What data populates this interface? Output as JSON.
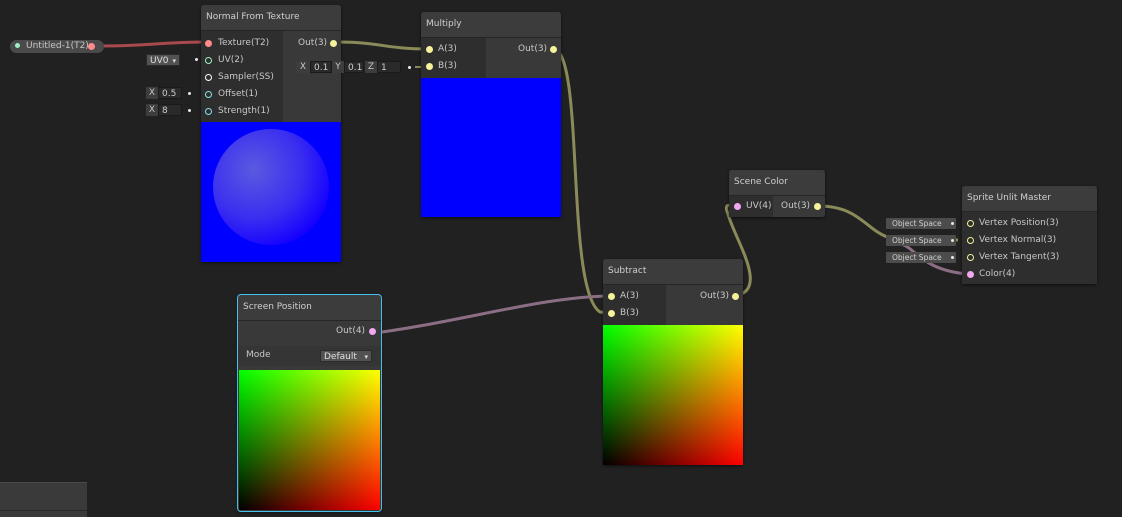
{
  "property_pill": {
    "label": "Untitled-1(T2)"
  },
  "normal_from_texture": {
    "title": "Normal From Texture",
    "inputs": [
      "Texture(T2)",
      "UV(2)",
      "Sampler(SS)",
      "Offset(1)",
      "Strength(1)"
    ],
    "output": "Out(3)",
    "uv_channel": "UV0",
    "offset": {
      "axis": "X",
      "value": "0.5"
    },
    "strength": {
      "axis": "X",
      "value": "8"
    }
  },
  "multiply": {
    "title": "Multiply",
    "inputs": [
      "A(3)",
      "B(3)"
    ],
    "output": "Out(3)",
    "b_value": {
      "x_label": "X",
      "x": "0.1",
      "y_label": "Y",
      "y": "0.1",
      "z_label": "Z",
      "z": "1"
    }
  },
  "screen_position": {
    "title": "Screen Position",
    "output": "Out(4)",
    "mode_label": "Mode",
    "mode_value": "Default"
  },
  "subtract": {
    "title": "Subtract",
    "inputs": [
      "A(3)",
      "B(3)"
    ],
    "output": "Out(3)"
  },
  "scene_color": {
    "title": "Scene Color",
    "input": "UV(4)",
    "output": "Out(3)"
  },
  "sprite_unlit_master": {
    "title": "Sprite Unlit Master",
    "inputs": [
      "Vertex Position(3)",
      "Vertex Normal(3)",
      "Vertex Tangent(3)",
      "Color(4)"
    ],
    "space_chips": [
      "Object Space",
      "Object Space",
      "Object Space"
    ]
  },
  "colors": {
    "wire_vec3": "#8a8b58",
    "wire_vec4": "#8c6e84",
    "wire_texture": "#a8494e",
    "selection_outline": "#44c0ec",
    "preview_blue": "#0000ff"
  }
}
